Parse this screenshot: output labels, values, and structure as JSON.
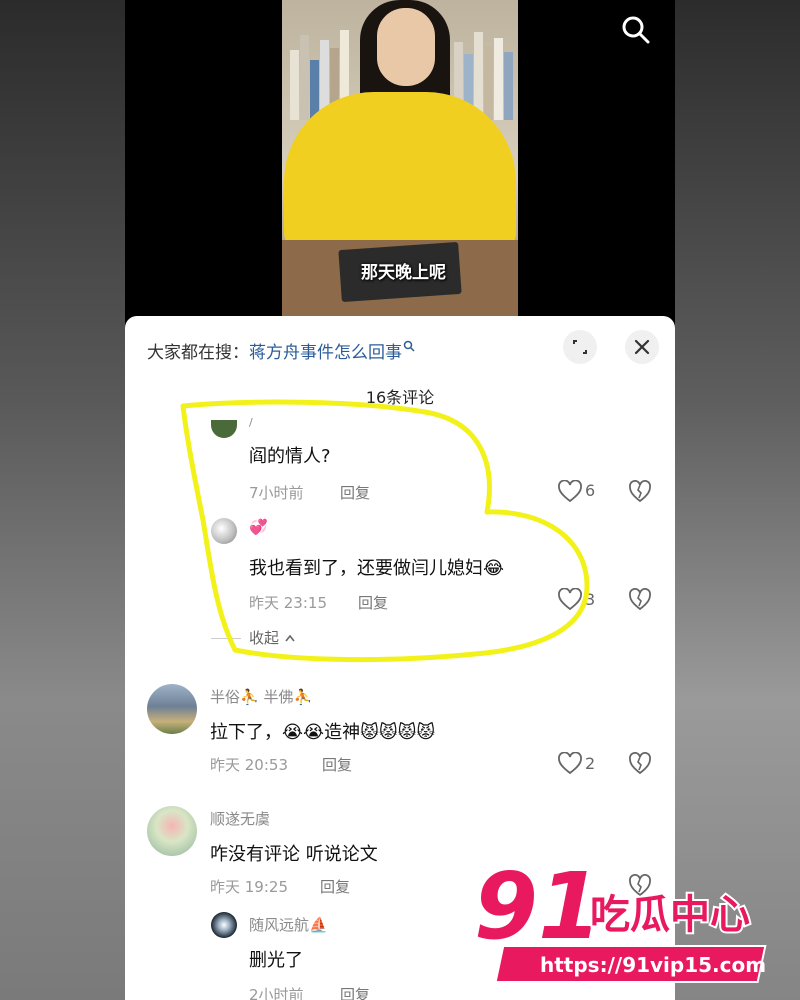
{
  "video": {
    "caption": "那天晚上呢",
    "search_icon": "search-icon"
  },
  "comments_sheet": {
    "search_prefix": "大家都在搜：",
    "search_term": "蒋方舟事件怎么回事",
    "count_label": "16条评论",
    "expand_icon": "expand-icon",
    "close_icon": "close-icon"
  },
  "comments": [
    {
      "name": "/",
      "text": "阎的情人?",
      "time": "7小时前",
      "reply": "回复",
      "likes": "6"
    },
    {
      "name": "💞",
      "text": "我也看到了，还要做闫儿媳妇😂",
      "time": "昨天 23:15",
      "reply": "回复",
      "likes": "3"
    },
    {
      "collapse": "收起"
    },
    {
      "name": "半俗⛹ 半佛⛹",
      "text": "拉下了，😭😭造神😾😾😾😾",
      "time": "昨天 20:53",
      "reply": "回复",
      "likes": "2"
    },
    {
      "name": "顺遂无虞",
      "text": "咋没有评论  听说论文",
      "time": "昨天 19:25",
      "reply": "回复",
      "likes": ""
    },
    {
      "name": "随风远航⛵",
      "text": "删光了",
      "time": "2小时前",
      "reply": "回复",
      "likes": ""
    }
  ],
  "watermark": {
    "number": "91",
    "brand": "吃瓜中心",
    "url": "https://91vip15.com"
  },
  "colors": {
    "highlight": "#f2f21a",
    "watermark_pink": "#e8195e",
    "link_blue": "#2b5c99",
    "sweater_yellow": "#f1cf21"
  }
}
